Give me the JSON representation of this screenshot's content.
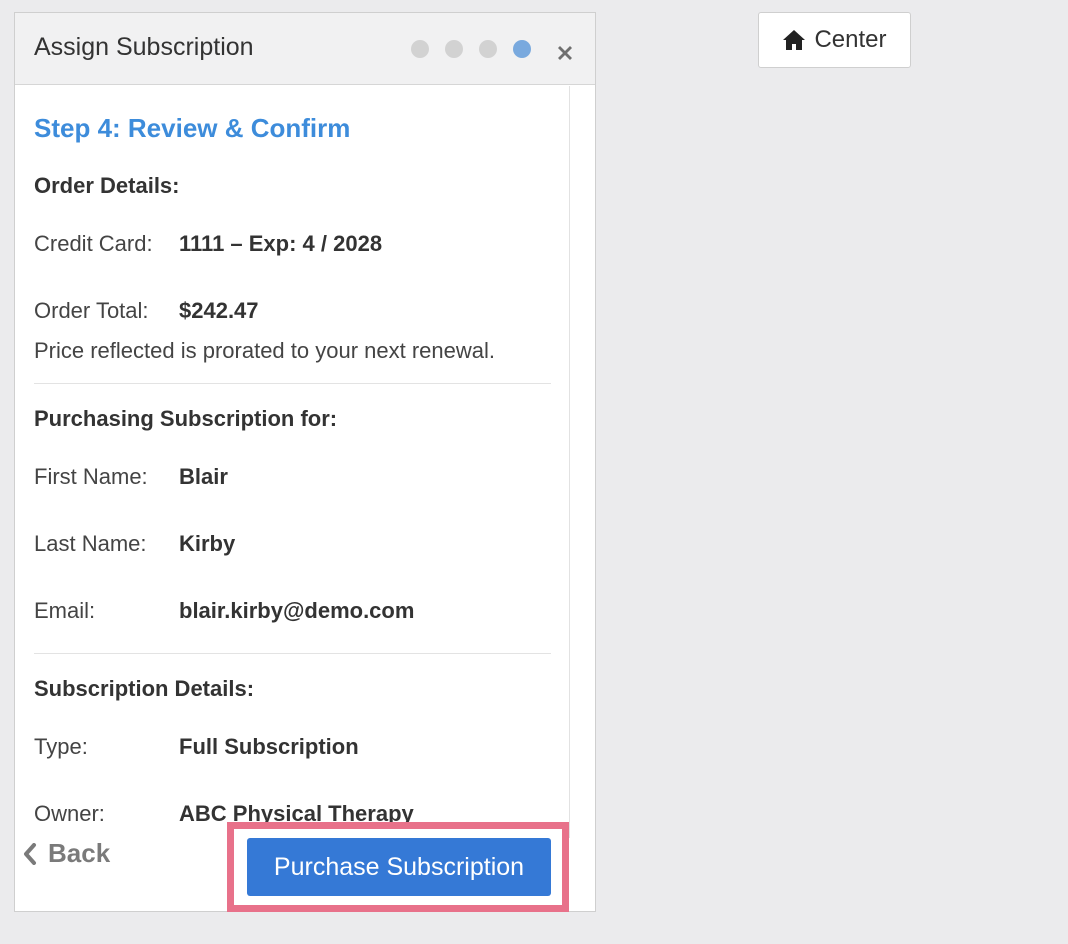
{
  "modal": {
    "title": "Assign Subscription",
    "steps_total": 4,
    "current_step": 4
  },
  "step_title": "Step 4: Review & Confirm",
  "order": {
    "heading": "Order Details:",
    "card_label": "Credit Card:",
    "card_value": "1111 – Exp: 4 / 2028",
    "total_label": "Order Total:",
    "total_value": "$242.47",
    "note": "Price reflected is prorated to your next renewal."
  },
  "purchaser": {
    "heading": "Purchasing Subscription for:",
    "first_label": "First Name:",
    "first_value": "Blair",
    "last_label": "Last Name:",
    "last_value": "Kirby",
    "email_label": "Email:",
    "email_value": "blair.kirby@demo.com"
  },
  "subscription": {
    "heading": "Subscription Details:",
    "type_label": "Type:",
    "type_value": "Full Subscription",
    "owner_label": "Owner:",
    "owner_value": "ABC Physical Therapy"
  },
  "footer": {
    "back_label": "Back",
    "purchase_label": "Purchase Subscription"
  },
  "toolbar": {
    "center_label": "Center"
  },
  "colors": {
    "accent": "#3d8cdb",
    "button": "#3579d6",
    "highlight": "#e8718a",
    "dot_active": "#79a9de",
    "dot_inactive": "#d2d2d2"
  },
  "icons": {
    "close": "close-icon",
    "back": "chevron-left-icon",
    "home": "home-icon"
  }
}
